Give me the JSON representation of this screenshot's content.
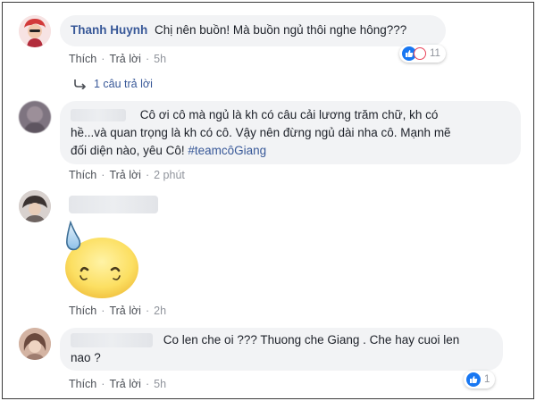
{
  "comments": [
    {
      "author": "Thanh Huynh",
      "text": "Chị nên buồn! Mà buồn ngủ thôi nghe hông???",
      "like": "Thích",
      "reply": "Trả lời",
      "time": "5h",
      "reaction_count": "11",
      "reactions": [
        "like-icon",
        "haha-icon"
      ],
      "replies_label": "1 câu trả lời"
    },
    {
      "text_line1": "Cô ơi cô mà ngủ là kh có câu cải lương trăm chữ, kh có",
      "text_line2": "hề...và quan trọng là kh có cô. Vậy nên đừng ngủ dài nha cô. Mạnh mẽ",
      "text_line3": "đối diện nào, yêu Cô!",
      "hashtag": "#teamcôGiang",
      "like": "Thích",
      "reply": "Trả lời",
      "time": "2 phút"
    },
    {
      "sticker": "sweat-face-sticker",
      "like": "Thích",
      "reply": "Trả lời",
      "time": "2h"
    },
    {
      "text_line1": "Co len che oi ??? Thuong che Giang . Che hay cuoi len",
      "text_line2": "nao ?",
      "like": "Thích",
      "reply": "Trả lời",
      "time": "5h",
      "reaction_count": "1",
      "reactions": [
        "like-icon"
      ]
    }
  ],
  "colors": {
    "link": "#385898",
    "bubble": "#f2f3f5",
    "meta": "#90949c",
    "like": "#1877f2",
    "haha": "#f7b125",
    "love": "#e9445a"
  }
}
